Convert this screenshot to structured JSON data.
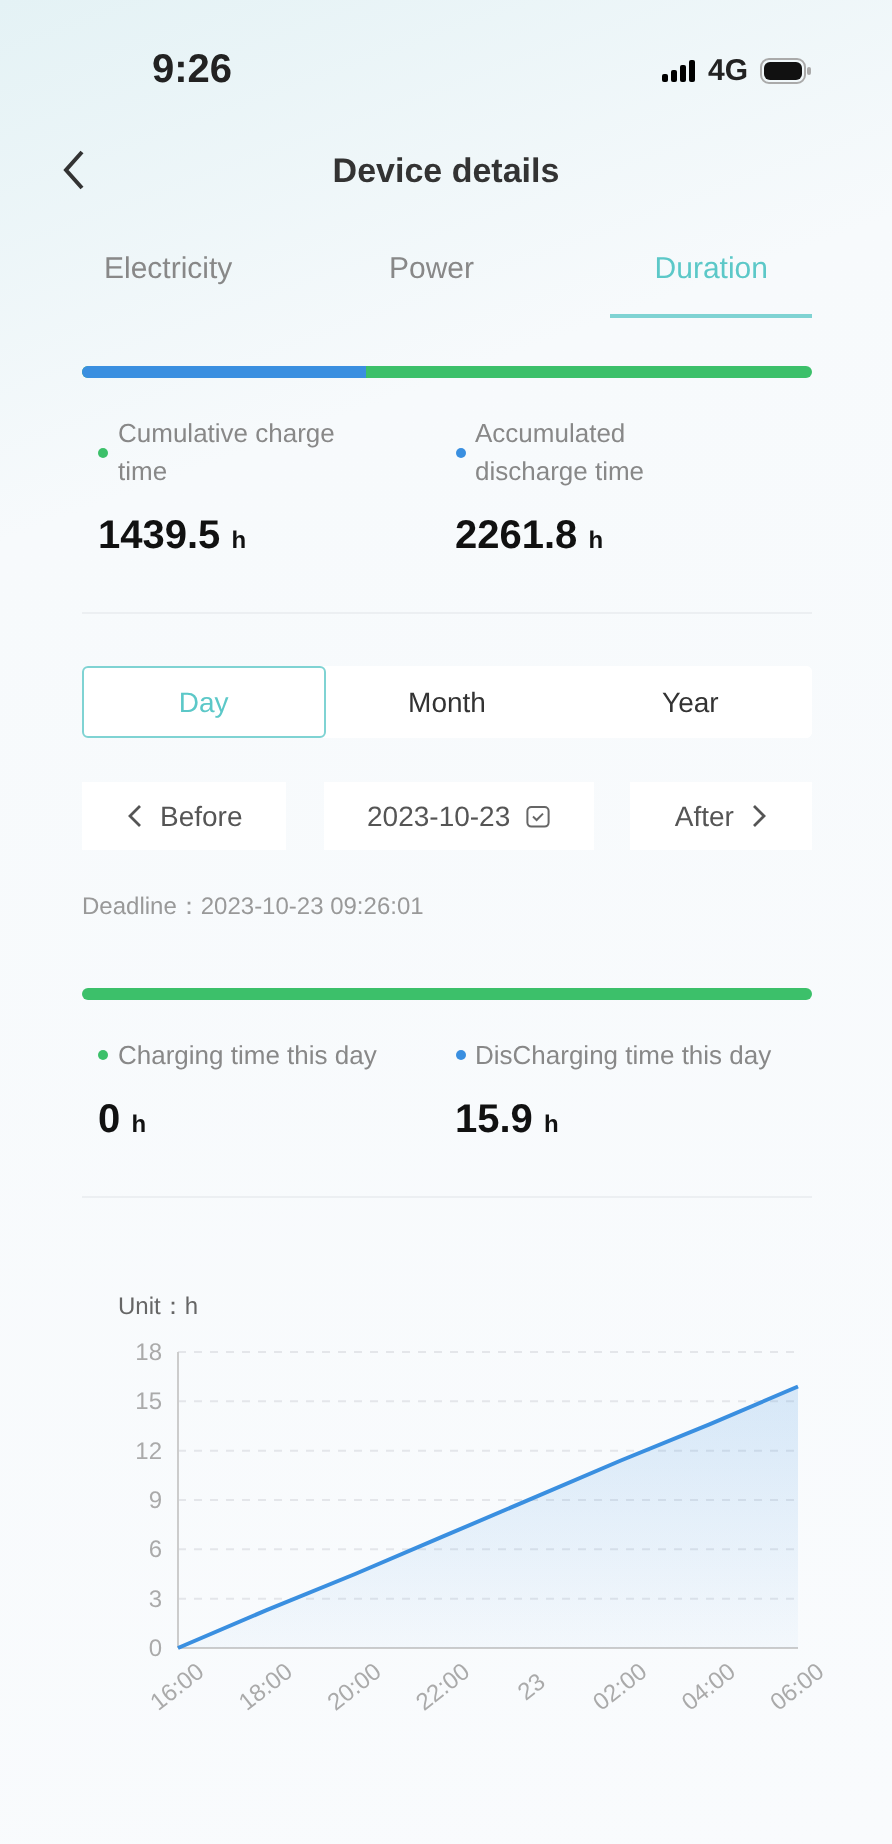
{
  "status_bar": {
    "time": "9:26",
    "network": "4G"
  },
  "header": {
    "title": "Device details"
  },
  "tabs": [
    {
      "label": "Electricity",
      "selected": false
    },
    {
      "label": "Power",
      "selected": false
    },
    {
      "label": "Duration",
      "selected": true
    }
  ],
  "total": {
    "ratio_bar": {
      "level": 0.39
    },
    "stats": [
      {
        "label": "Cumulative charge time",
        "value": "1439.5",
        "unit": "h",
        "color": "#3cc06a"
      },
      {
        "label": "Accumulated discharge time",
        "value": "2261.8",
        "unit": "h",
        "color": "#3a8fe0"
      }
    ]
  },
  "periods": [
    {
      "label": "Day",
      "selected": true
    },
    {
      "label": "Month",
      "selected": false
    },
    {
      "label": "Year",
      "selected": false
    }
  ],
  "date_nav": {
    "before": "Before",
    "date": "2023-10-23",
    "after": "After"
  },
  "deadline": "Deadline：2023-10-23 09:26:01",
  "day": {
    "ratio_bar": {
      "level": 0
    },
    "stats": [
      {
        "label": "Charging time this day",
        "value": "0",
        "unit": "h",
        "color": "#3cc06a"
      },
      {
        "label": "DisCharging time this day",
        "value": "15.9",
        "unit": "h",
        "color": "#3a8fe0"
      }
    ]
  },
  "chart": {
    "unit_label": "Unit：h",
    "chart_data": {
      "type": "area",
      "categories": [
        "16:00",
        "18:00",
        "20:00",
        "22:00",
        "23",
        "02:00",
        "04:00",
        "06:00"
      ],
      "grid": true,
      "series": [
        {
          "color": "#3a8fe0",
          "values": [
            0,
            2.3,
            4.5,
            6.8,
            9.1,
            11.4,
            13.6,
            15.9
          ]
        }
      ],
      "ylim": [
        0,
        18
      ],
      "yticks": [
        0,
        3,
        6,
        9,
        12,
        15,
        18
      ]
    }
  }
}
